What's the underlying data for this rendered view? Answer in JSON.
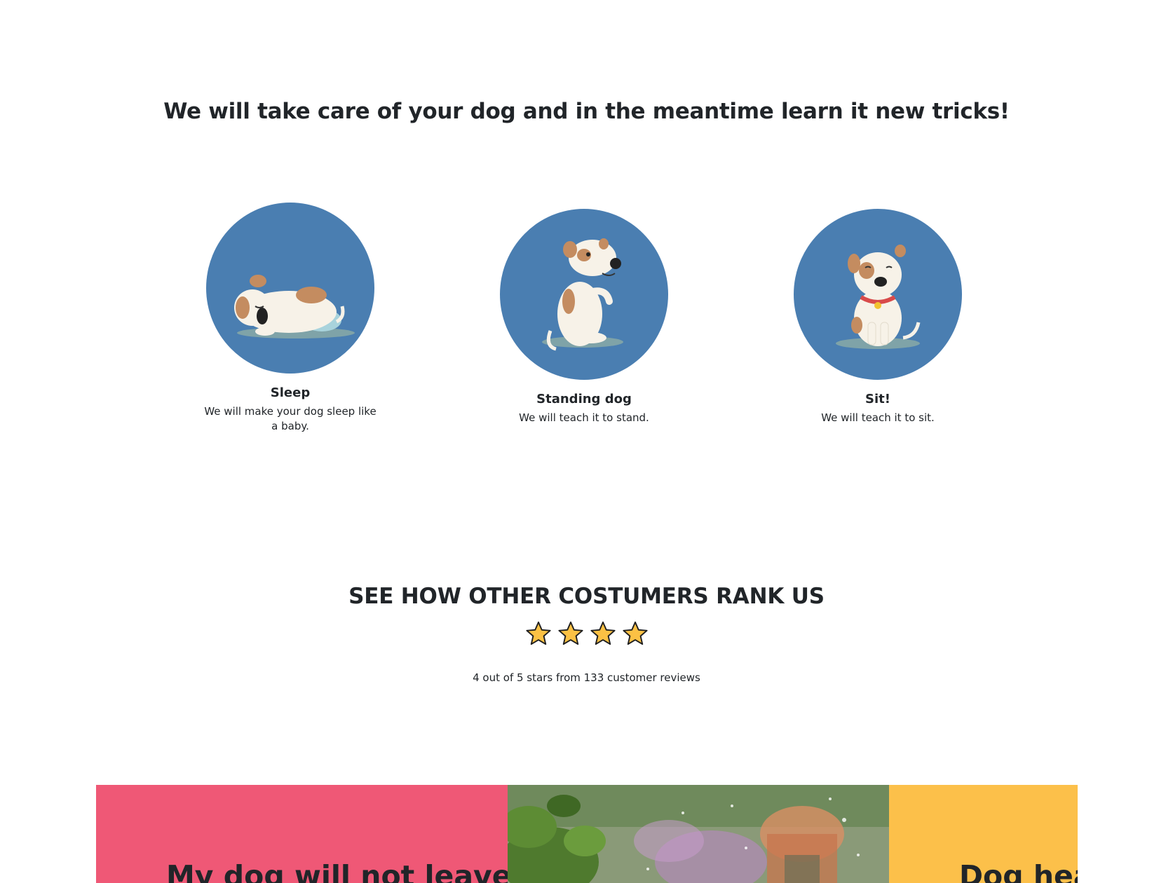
{
  "intro": {
    "heading": "We will take care of your dog and in the meantime learn it new tricks!"
  },
  "features": [
    {
      "title": "Sleep",
      "text": "We will make your dog sleep like a baby.",
      "icon": "sleeping-dog-icon"
    },
    {
      "title": "Standing dog",
      "text": "We will teach it to stand.",
      "icon": "standing-dog-icon"
    },
    {
      "title": "Sit!",
      "text": "We will teach it to sit.",
      "icon": "sitting-dog-icon"
    }
  ],
  "ranking": {
    "heading": "SEE HOW OTHER COSTUMERS RANK US",
    "stars_shown": 4,
    "rating": 4,
    "max_rating": 5,
    "review_count": 133,
    "summary": "4 out of 5 stars from 133 customer reviews"
  },
  "panels": [
    {
      "heading": "My dog will not leave",
      "color": "#ef5876"
    },
    {
      "image": "garden-photo",
      "color": "#7d8f6b"
    },
    {
      "heading": "Dog heav",
      "color": "#fcc04a"
    }
  ],
  "colors": {
    "circle": "#4a7eb1",
    "star": "#fbc144",
    "text": "#212529"
  }
}
